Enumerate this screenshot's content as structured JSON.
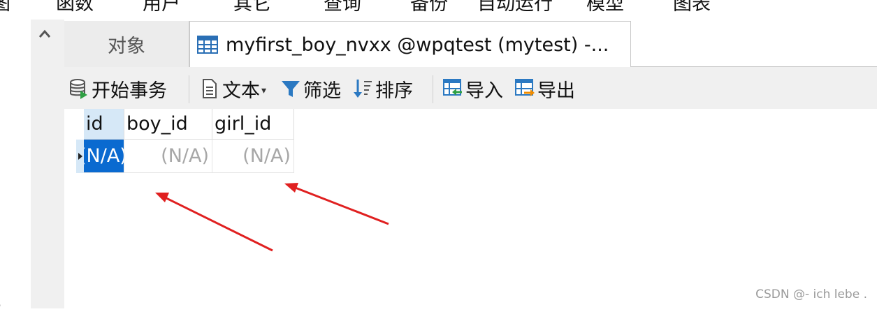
{
  "menu": {
    "items": [
      "图",
      "函数",
      "用户",
      "其它",
      "查询",
      "备份",
      "自动运行",
      "模型",
      "图表"
    ]
  },
  "tabs": {
    "objects_label": "对象",
    "active_label": "myfirst_boy_nvxx @wpqtest (mytest) -..."
  },
  "toolbar": {
    "begin_transaction": "开始事务",
    "text": "文本",
    "filter": "筛选",
    "sort": "排序",
    "import": "导入",
    "export": "导出"
  },
  "grid": {
    "columns": [
      "id",
      "boy_id",
      "girl_id"
    ],
    "rows": [
      [
        "(N/A)",
        "(N/A)",
        "(N/A)"
      ]
    ]
  },
  "annotation": {
    "arrow_color": "#e02020"
  },
  "colors": {
    "selection": "#0a6ad0",
    "header_selected": "#d6e8f7",
    "null_text": "#a7a7a7"
  },
  "watermark": "CSDN @- ich lebe ."
}
